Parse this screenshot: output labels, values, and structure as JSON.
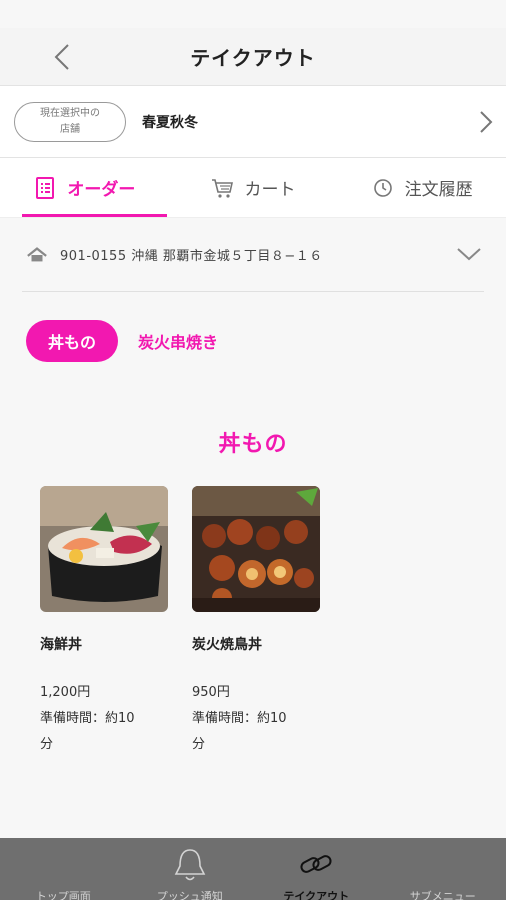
{
  "nav": {
    "title": "テイクアウト"
  },
  "store": {
    "badge_line1": "現在選択中の",
    "badge_line2": "店舗",
    "name": "春夏秋冬"
  },
  "tabs": [
    {
      "label": "オーダー",
      "icon": "order-list-icon",
      "active": true
    },
    {
      "label": "カート",
      "icon": "cart-icon",
      "active": false
    },
    {
      "label": "注文履歴",
      "icon": "clock-icon",
      "active": false
    }
  ],
  "address": {
    "text": "901-0155 沖縄 那覇市金城５丁目８−１６"
  },
  "categories": [
    {
      "label": "丼もの",
      "active": true
    },
    {
      "label": "炭火串焼き",
      "active": false
    }
  ],
  "section": {
    "title": "丼もの"
  },
  "products": [
    {
      "name": "海鮮丼",
      "price": "1,200円",
      "prep_line1": "準備時間：約10",
      "prep_line2": "分",
      "image": "seafood-bowl-photo"
    },
    {
      "name": "炭火焼鳥丼",
      "price": "950円",
      "prep_line1": "準備時間：約10",
      "prep_line2": "分",
      "image": "yakitori-bowl-photo"
    }
  ],
  "bottom_nav": [
    {
      "label": "トップ画面",
      "icon": "home-icon",
      "active": false
    },
    {
      "label": "プッシュ通知",
      "icon": "bell-icon",
      "active": false
    },
    {
      "label": "テイクアウト",
      "icon": "link-icon",
      "active": true
    },
    {
      "label": "サブメニュー",
      "icon": "menu-icon",
      "active": false
    }
  ],
  "colors": {
    "accent": "#f218b0",
    "bottom_nav_bg": "#6f6f6f"
  }
}
